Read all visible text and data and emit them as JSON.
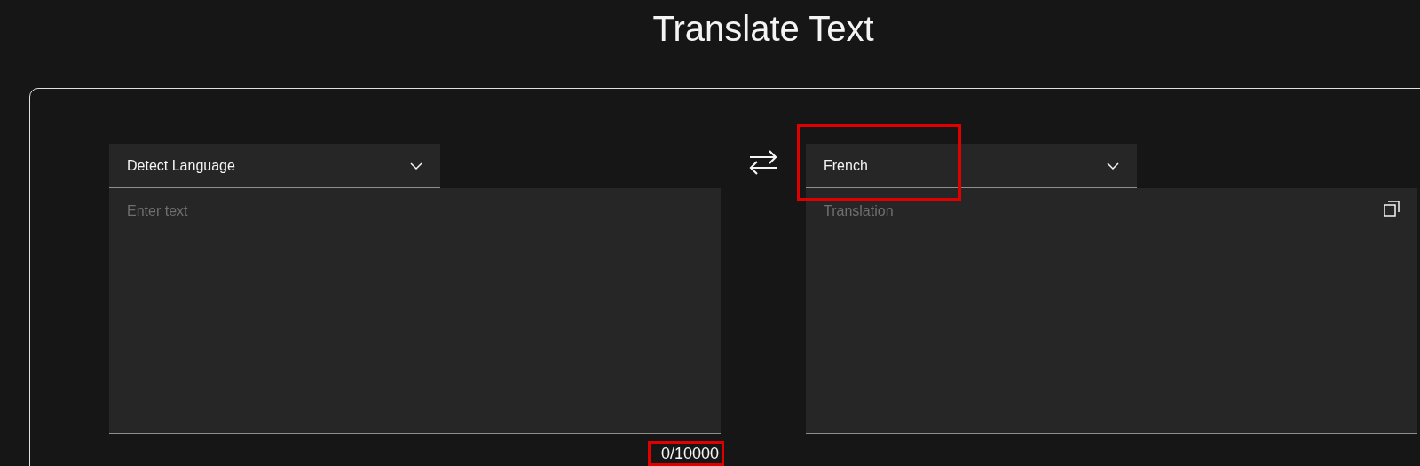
{
  "title": "Translate Text",
  "source": {
    "language": "Detect Language",
    "placeholder": "Enter text",
    "counter": "0/10000",
    "counter_highlighted": true
  },
  "target": {
    "language": "French",
    "placeholder": "Translation",
    "language_highlighted": true
  }
}
